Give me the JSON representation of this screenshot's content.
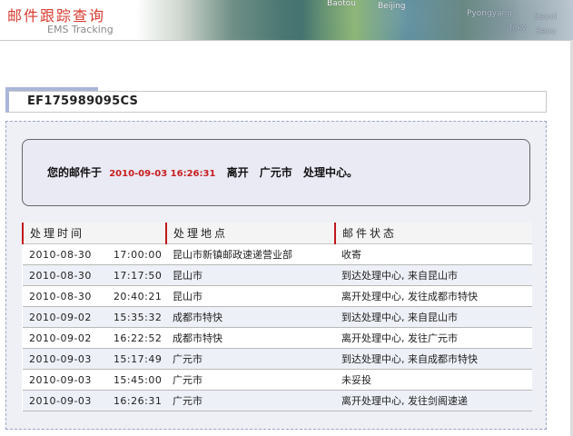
{
  "header": {
    "title_cn": "邮件跟踪查询",
    "title_en": "EMS Tracking",
    "map_labels": [
      "Baotou",
      "Beijing",
      "Pyongyang",
      "Seoul",
      "Toky",
      "Seou"
    ]
  },
  "tracking": {
    "number": "EF175989095CS"
  },
  "status": {
    "prefix": "您的邮件于",
    "timestamp": "2010-09-03 16:26:31",
    "action": "离开",
    "city": "广元市",
    "place": "处理中心。"
  },
  "table": {
    "headers": [
      "处理时间",
      "处理地点",
      "邮件状态"
    ],
    "rows": [
      {
        "date": "2010-08-30",
        "time": "17:00:00",
        "location": "昆山市新镇邮政速递营业部",
        "status": "收寄"
      },
      {
        "date": "2010-08-30",
        "time": "17:17:50",
        "location": "昆山市",
        "status": "到达处理中心, 来自昆山市"
      },
      {
        "date": "2010-08-30",
        "time": "20:40:21",
        "location": "昆山市",
        "status": "离开处理中心, 发往成都市特快"
      },
      {
        "date": "2010-09-02",
        "time": "15:35:32",
        "location": "成都市特快",
        "status": "到达处理中心, 来自昆山市"
      },
      {
        "date": "2010-09-02",
        "time": "16:22:52",
        "location": "成都市特快",
        "status": "离开处理中心, 发往广元市"
      },
      {
        "date": "2010-09-03",
        "time": "15:17:49",
        "location": "广元市",
        "status": "到达处理中心, 来自成都市特快"
      },
      {
        "date": "2010-09-03",
        "time": "15:45:00",
        "location": "广元市",
        "status": "未妥投"
      },
      {
        "date": "2010-09-03",
        "time": "16:26:31",
        "location": "广元市",
        "status": "离开处理中心, 发往剑阁速递"
      }
    ]
  },
  "colors": {
    "title_red": "#d73a2f",
    "timestamp_red": "#c81e1e",
    "panel_bg": "#eef0f6",
    "tab_accent": "#aab5d9"
  }
}
